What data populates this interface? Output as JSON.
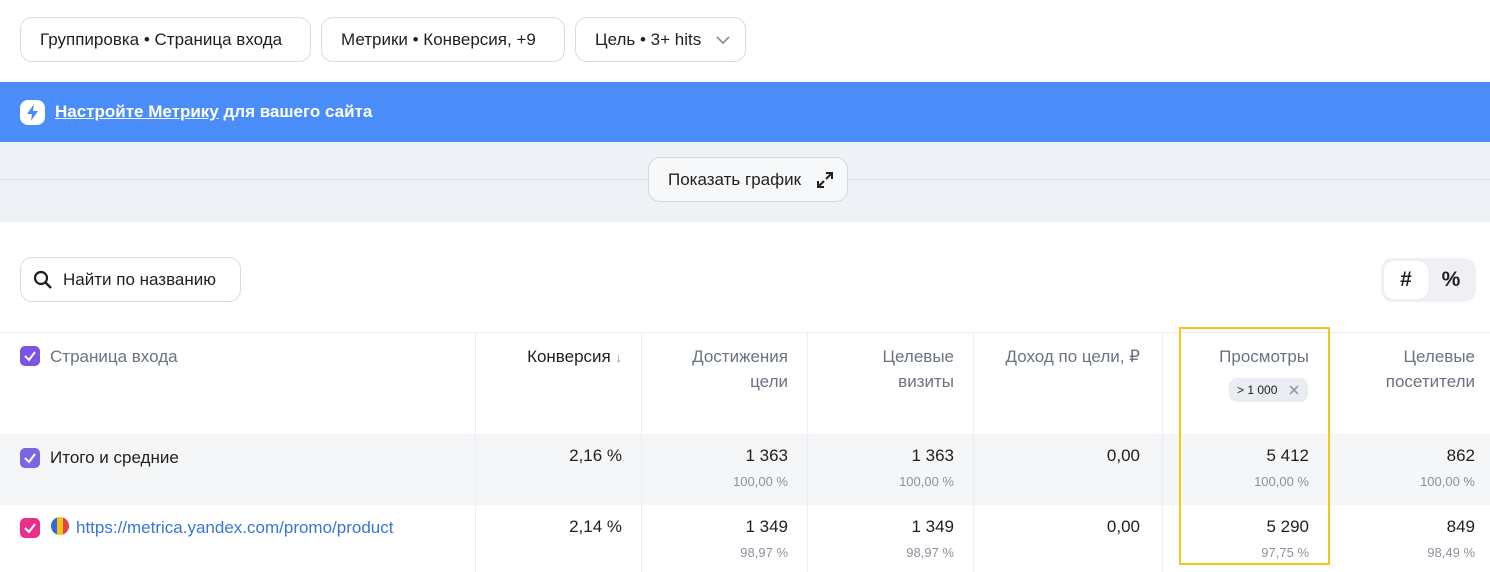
{
  "filters": {
    "grouping": "Группировка • Страница входа",
    "metrics": "Метрики • Конверсия, +9",
    "goal": "Цель • 3+ hits"
  },
  "banner": {
    "link_text": "Настройте Метрику",
    "rest_text": " для вашего сайта",
    "bg_color": "#4b8df8"
  },
  "chart_toggle": {
    "label": "Показать график"
  },
  "search": {
    "placeholder": "Найти по названию"
  },
  "view_toggle": {
    "absolute": "#",
    "percent": "%"
  },
  "table": {
    "headers": {
      "dimension": "Страница входа",
      "conversion": "Конверсия",
      "sort_arrow": "↓",
      "goal_reaches_1": "Достижения",
      "goal_reaches_2": "цели",
      "target_visits_1": "Целевые",
      "target_visits_2": "визиты",
      "goal_revenue": "Доход по цели, ₽",
      "pageviews": "Просмотры",
      "pageviews_filter": "> 1 000",
      "target_visitors_1": "Целевые",
      "target_visitors_2": "посетители"
    },
    "total": {
      "label": "Итого и средние",
      "conversion": "2,16 %",
      "goal_reaches": "1 363",
      "goal_reaches_pct": "100,00 %",
      "target_visits": "1 363",
      "target_visits_pct": "100,00 %",
      "goal_revenue": "0,00",
      "pageviews": "5 412",
      "pageviews_pct": "100,00 %",
      "target_visitors": "862",
      "target_visitors_pct": "100,00 %"
    },
    "rows": [
      {
        "label": "https://metrica.yandex.com/promo/product",
        "conversion": "2,14 %",
        "goal_reaches": "1 349",
        "goal_reaches_pct": "98,97 %",
        "target_visits": "1 349",
        "target_visits_pct": "98,97 %",
        "goal_revenue": "0,00",
        "pageviews": "5 290",
        "pageviews_pct": "97,75 %",
        "target_visitors": "849",
        "target_visitors_pct": "98,49 %"
      }
    ]
  },
  "colors": {
    "checkbox_header": "#7b54e5",
    "checkbox_total": "#7a66e0",
    "checkbox_row": "#e8308a",
    "highlight": "#f5c518",
    "link": "#3776d8"
  }
}
